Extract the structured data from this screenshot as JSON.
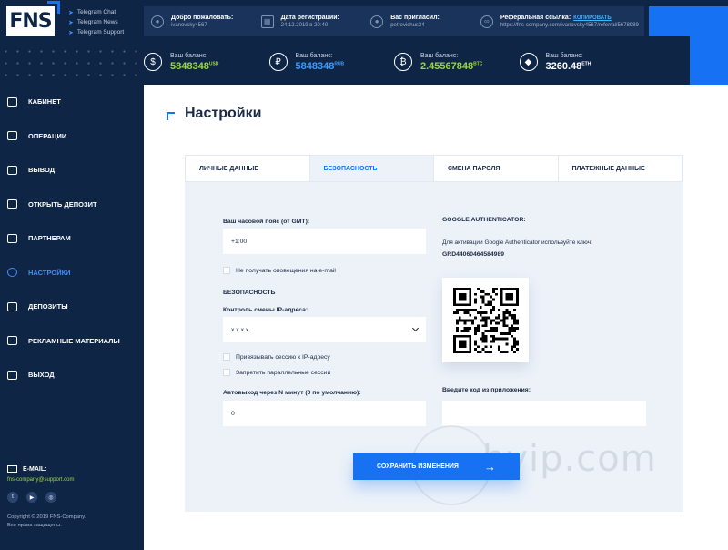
{
  "header": {
    "logo_text": "FNS",
    "telegram_links": [
      "Telegram Chat",
      "Telegram News",
      "Telegram Support"
    ],
    "info": [
      {
        "icon": "user-icon",
        "title": "Добро пожаловать:",
        "value": "ivanovsky4567"
      },
      {
        "icon": "calendar-icon",
        "title": "Дата регистрации:",
        "value": "24.12.2019 в 20:40"
      },
      {
        "icon": "users-icon",
        "title": "Вас пригласил:",
        "value": "petrovichus34"
      },
      {
        "icon": "link-icon",
        "title": "Реферальная ссылка:",
        "copy_label": "КОПИРОВАТЬ",
        "value": "https://fns-company.com/ivanovsky4567/referral/5678989"
      }
    ],
    "balances": [
      {
        "icon": "dollar-coin-icon",
        "symbol": "$",
        "label": "Ваш баланс:",
        "amount": "5848348",
        "currency": "USD",
        "color": "#9bd83a"
      },
      {
        "icon": "ruble-coin-icon",
        "symbol": "₽",
        "label": "Ваш баланс:",
        "amount": "5848348",
        "currency": "RUB",
        "color": "#3d9bff"
      },
      {
        "icon": "bitcoin-coin-icon",
        "symbol": "₿",
        "label": "Ваш баланс:",
        "amount": "2.45567848",
        "currency": "BTC",
        "color": "#9bd83a"
      },
      {
        "icon": "ethereum-coin-icon",
        "symbol": "◆",
        "label": "Ваш баланс:",
        "amount": "3260.48",
        "currency": "ETH",
        "color": "#ffffff"
      }
    ]
  },
  "sidebar": {
    "items": [
      {
        "label": "КАБИНЕТ",
        "icon": "dashboard-icon",
        "active": false
      },
      {
        "label": "ОПЕРАЦИИ",
        "icon": "operations-icon",
        "active": false
      },
      {
        "label": "ВЫВОД",
        "icon": "withdraw-icon",
        "active": false
      },
      {
        "label": "ОТКРЫТЬ ДЕПОЗИТ",
        "icon": "deposit-open-icon",
        "active": false
      },
      {
        "label": "ПАРТНЕРАМ",
        "icon": "partners-icon",
        "active": false
      },
      {
        "label": "НАСТРОЙКИ",
        "icon": "settings-icon",
        "active": true
      },
      {
        "label": "ДЕПОЗИТЫ",
        "icon": "deposits-icon",
        "active": false
      },
      {
        "label": "РЕКЛАМНЫЕ МАТЕРИАЛЫ",
        "icon": "promo-icon",
        "active": false
      },
      {
        "label": "ВЫХОД",
        "icon": "logout-icon",
        "active": false
      }
    ],
    "email_label": "E-MAIL:",
    "email": "fns-company@support.com",
    "socials": [
      "twitter-icon",
      "youtube-icon",
      "instagram-icon"
    ],
    "copyright_line1": "Copyright © 2019 FNS-Company.",
    "copyright_line2": "Все права защищены."
  },
  "main": {
    "title": "Настройки",
    "tabs": [
      {
        "label": "ЛИЧНЫЕ ДАННЫЕ",
        "active": false
      },
      {
        "label": "БЕЗОПАСНОСТЬ",
        "active": true
      },
      {
        "label": "СМЕНА ПАРОЛЯ",
        "active": false
      },
      {
        "label": "ПЛАТЕЖНЫЕ ДАННЫЕ",
        "active": false
      }
    ],
    "timezone_label": "Ваш часовой пояс (от GMT):",
    "timezone_value": "+1:00",
    "no_email_notifications": "Не получать оповещения на e-mail",
    "security_heading": "БЕЗОПАСНОСТЬ",
    "ip_control_label": "Контроль смены IP-адреса:",
    "ip_control_value": "x.x.x.x",
    "bind_session_ip": "Привязывать сессию к IP-адресу",
    "forbid_parallel": "Запретить параллельные сессии",
    "autologout_label": "Автовыход через N минут (0 по умолчанию):",
    "autologout_value": "0",
    "ga_heading": "GOOGLE AUTHENTICATOR:",
    "ga_description": "Для активации Google Authenticator используйте ключ:",
    "ga_key": "GRD44060464584989",
    "app_code_label": "Введите код из приложения:",
    "app_code_value": "",
    "save_label": "СОХРАНИТЬ ИЗМЕНЕНИЯ",
    "watermark": "hyip.com"
  }
}
